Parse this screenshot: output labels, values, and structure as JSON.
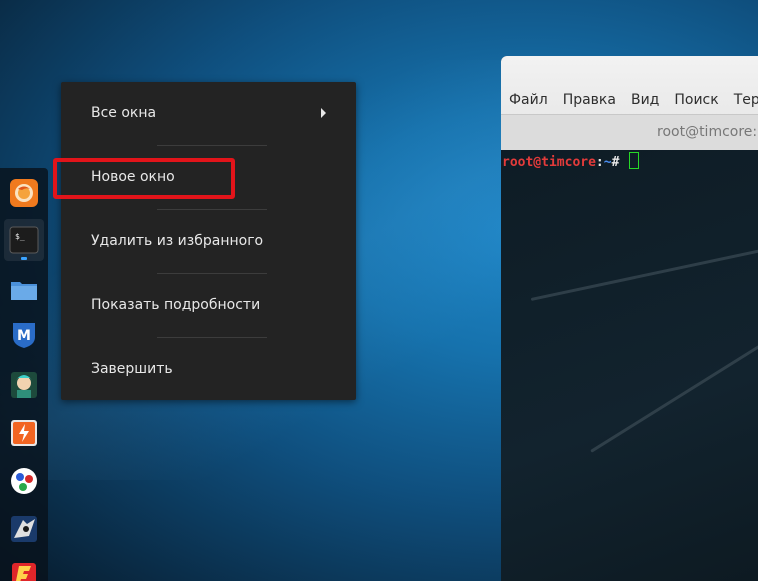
{
  "menu": {
    "items": [
      {
        "label": "Все окна",
        "has_submenu": true
      },
      {
        "label": "Новое окно",
        "has_submenu": false
      },
      {
        "label": "Удалить из избранного",
        "has_submenu": false
      },
      {
        "label": "Показать подробности",
        "has_submenu": false
      },
      {
        "label": "Завершить",
        "has_submenu": false
      }
    ],
    "highlighted_item": "Новое окно",
    "highlight_color": "#e2141a"
  },
  "dock": {
    "apps": [
      {
        "name": "firefox-icon"
      },
      {
        "name": "terminal-icon",
        "active": true,
        "glyph": "$_"
      },
      {
        "name": "files-icon"
      },
      {
        "name": "metasploit-icon",
        "glyph": "M"
      },
      {
        "name": "armitage-icon"
      },
      {
        "name": "burpsuite-icon"
      },
      {
        "name": "maltego-icon"
      },
      {
        "name": "beef-icon"
      },
      {
        "name": "faraday-icon"
      }
    ]
  },
  "terminal": {
    "menu": [
      "Файл",
      "Правка",
      "Вид",
      "Поиск",
      "Терми"
    ],
    "title": "root@timcore:",
    "prompt": {
      "user": "root@timcore",
      "sep": ":",
      "path": "~",
      "symbol": "#"
    }
  },
  "colors": {
    "prompt_user": "#e33b3b",
    "prompt_path": "#4a8df0",
    "cursor": "#27d827"
  }
}
